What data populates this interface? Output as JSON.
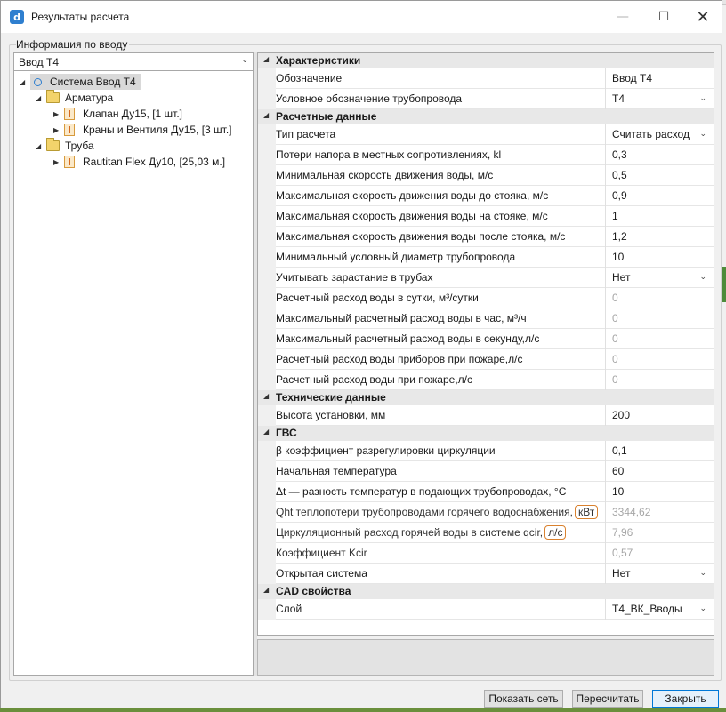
{
  "window": {
    "title": "Результаты расчета",
    "controls": {
      "minimize": "—",
      "maximize": "☐",
      "close": "✕"
    }
  },
  "input_group": {
    "label": "Информация по вводу",
    "selector_value": "Ввод Т4"
  },
  "tree": {
    "root": "Система Ввод Т4",
    "folders": [
      {
        "label": "Арматура",
        "items": [
          "Клапан Ду15, [1 шт.]",
          "Краны и Вентиля Ду15, [3 шт.]"
        ]
      },
      {
        "label": "Труба",
        "items": [
          "Rautitan Flex Ду10, [25,03 м.]"
        ]
      }
    ]
  },
  "properties": {
    "cat_characteristics": "Характеристики",
    "designation": {
      "label": "Обозначение",
      "value": "Ввод Т4"
    },
    "pipe_symbol": {
      "label": "Условное обозначение трубопровода",
      "value": "Т4"
    },
    "cat_calc": "Расчетные данные",
    "calc_type": {
      "label": "Тип расчета",
      "value": "Считать расход"
    },
    "head_loss": {
      "label": "Потери напора в местных сопротивлениях, kl",
      "value": "0,3"
    },
    "min_speed": {
      "label": "Минимальная скорость движения воды, м/с",
      "value": "0,5"
    },
    "max_speed_before": {
      "label": "Максимальная скорость движения воды до стояка, м/с",
      "value": "0,9"
    },
    "max_speed_on": {
      "label": "Максимальная скорость движения воды на стояке, м/с",
      "value": "1"
    },
    "max_speed_after": {
      "label": "Максимальная скорость движения воды после стояка, м/с",
      "value": "1,2"
    },
    "min_diameter": {
      "label": "Минимальный условный диаметр трубопровода",
      "value": "10"
    },
    "overgrowth": {
      "label": "Учитывать зарастание в трубах",
      "value": "Нет"
    },
    "daily_flow": {
      "label": "Расчетный расход воды в сутки, м³/сутки",
      "value": "0"
    },
    "hourly_flow": {
      "label": "Максимальный расчетный расход воды в час, м³/ч",
      "value": "0"
    },
    "second_flow": {
      "label": "Максимальный расчетный расход воды в секунду,л/с",
      "value": "0"
    },
    "fire_devices_flow": {
      "label": "Расчетный расход воды приборов при пожаре,л/с",
      "value": "0"
    },
    "fire_flow": {
      "label": "Расчетный расход воды при пожаре,л/с",
      "value": "0"
    },
    "cat_tech": "Технические данные",
    "install_height": {
      "label": "Высота установки, мм",
      "value": "200"
    },
    "cat_gvs": "ГВС",
    "beta": {
      "label": "β  коэффициент разрегулировки циркуляции",
      "value": "0,1"
    },
    "start_temp": {
      "label": "Начальная температура",
      "value": "60"
    },
    "delta_t": {
      "label": "Δt — разность температур в подающих трубопроводах, °C",
      "value": "10"
    },
    "qht": {
      "label": "Qht  теплопотери трубопроводами горячего водоснабжения,",
      "unit": "кВт",
      "value": "3344,62"
    },
    "qcir": {
      "label": "Циркуляционный расход горячей воды в системе qcir,",
      "unit": "л/с",
      "value": "7,96"
    },
    "kcir": {
      "label": "Коэффициент Kcir",
      "value": "0,57"
    },
    "open_system": {
      "label": "Открытая система",
      "value": "Нет"
    },
    "cat_cad": "CAD свойства",
    "layer": {
      "label": "Слой",
      "value": "Т4_ВК_Вводы"
    }
  },
  "buttons": {
    "show_network": "Показать сеть",
    "recalc": "Пересчитать",
    "close": "Закрыть"
  },
  "colors": {
    "accent": "#0078d7",
    "highlight_outline": "#d9812e"
  }
}
